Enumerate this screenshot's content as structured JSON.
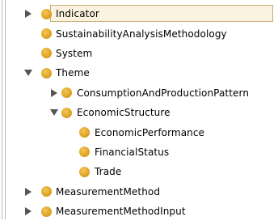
{
  "tree": {
    "items": [
      {
        "label": "Indicator",
        "level": 0,
        "toggle": "collapsed",
        "selected": true
      },
      {
        "label": "SustainabilityAnalysisMethodology",
        "level": 0,
        "toggle": "none",
        "selected": false
      },
      {
        "label": "System",
        "level": 0,
        "toggle": "none",
        "selected": false
      },
      {
        "label": "Theme",
        "level": 0,
        "toggle": "expanded",
        "selected": false
      },
      {
        "label": "ConsumptionAndProductionPattern",
        "level": 1,
        "toggle": "collapsed",
        "selected": false
      },
      {
        "label": "EconomicStructure",
        "level": 1,
        "toggle": "expanded",
        "selected": false
      },
      {
        "label": "EconomicPerformance",
        "level": 2,
        "toggle": "none",
        "selected": false
      },
      {
        "label": "FinancialStatus",
        "level": 2,
        "toggle": "none",
        "selected": false
      },
      {
        "label": "Trade",
        "level": 2,
        "toggle": "none",
        "selected": false
      },
      {
        "label": "MeasurementMethod",
        "level": 0,
        "toggle": "collapsed",
        "selected": false
      },
      {
        "label": "MeasurementMethodInput",
        "level": 0,
        "toggle": "collapsed",
        "selected": false
      }
    ]
  },
  "icons": {
    "class_icon": "class-circle-icon",
    "expand_icon": "triangle-right-icon",
    "collapse_icon": "triangle-down-icon"
  },
  "colors": {
    "class_icon": "#e1a626",
    "selection_fill": "#fbf3df",
    "selection_border": "#c9ad7a",
    "toggle": "#555555"
  }
}
